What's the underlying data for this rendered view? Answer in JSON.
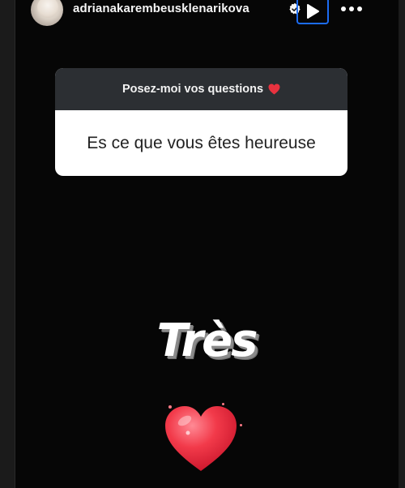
{
  "header": {
    "username": "adrianakarembeusklenarikova",
    "verified_icon": "verified-badge-icon",
    "play_icon": "play-icon",
    "more_icon": "more-dots-icon",
    "accent": "#1c6cf2"
  },
  "question_sticker": {
    "prompt": "Posez-moi vos questions",
    "prompt_emoji_icon": "red-heart-icon",
    "question": "Es ce que vous êtes heureuse"
  },
  "answer": {
    "text": "Très",
    "sticker_icon": "red-heart-icon",
    "heart_color": "#f0303f"
  }
}
